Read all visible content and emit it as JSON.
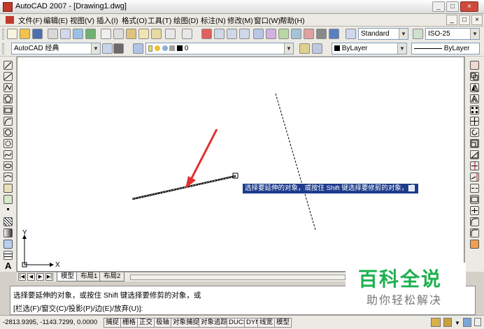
{
  "window": {
    "title": "AutoCAD 2007 - [Drawing1.dwg]",
    "controls": [
      "_",
      "□",
      "×"
    ]
  },
  "menubar": {
    "items": [
      "文件(F)",
      "编辑(E)",
      "视图(V)",
      "插入(I)",
      "格式(O)",
      "工具(T)",
      "绘图(D)",
      "标注(N)",
      "修改(M)",
      "窗口(W)",
      "帮助(H)"
    ],
    "doc_controls": [
      "_",
      "□",
      "×"
    ]
  },
  "toolbar_standard": {
    "text_style": "Standard",
    "dim_style": "ISO-25"
  },
  "toolbar_layers": {
    "workspace": "AutoCAD 经典",
    "current_layer": "0",
    "color": "ByLayer",
    "linetype": "ByLayer"
  },
  "canvas": {
    "ucs_x_label": "X",
    "ucs_y_label": "Y",
    "tooltip_text": "选择要延伸的对象，或按住 Shift 键选择要修剪的对象，或",
    "accent_arrow_color": "#e03030",
    "line_color": "#000000"
  },
  "layout_tabs": {
    "nav": [
      "|◀",
      "◀",
      "▶",
      "▶|"
    ],
    "tabs": [
      "模型",
      "布局1",
      "布局2"
    ],
    "active": "模型"
  },
  "command": {
    "line1": "选择要延伸的对象，或按住 Shift 键选择要修剪的对象，或",
    "line2": "[栏选(F)/窗交(C)/投影(P)/边(E)/放弃(U)]:"
  },
  "statusbar": {
    "coordinates": "-2813.9395, -1143.7299, 0.0000",
    "toggles": [
      "捕捉",
      "栅格",
      "正交",
      "极轴",
      "对象捕捉",
      "对象追踪",
      "DUCS",
      "DYN",
      "线宽",
      "模型"
    ]
  },
  "watermark": {
    "logo": "百科全说",
    "subtitle": "助你轻松解决"
  },
  "icons": {
    "left_toolbar": [
      "line-icon",
      "construction-line-icon",
      "polyline-icon",
      "polygon-icon",
      "rectangle-icon",
      "arc-icon",
      "circle-icon",
      "revision-cloud-icon",
      "spline-icon",
      "ellipse-icon",
      "ellipse-arc-icon",
      "insert-block-icon",
      "make-block-icon",
      "point-icon",
      "hatch-icon",
      "gradient-icon",
      "region-icon",
      "table-icon",
      "mtext-icon"
    ],
    "right_toolbar": [
      "erase-icon",
      "copy-icon",
      "mirror-icon",
      "offset-icon",
      "array-icon",
      "move-icon",
      "rotate-icon",
      "scale-icon",
      "stretch-icon",
      "trim-icon",
      "extend-icon",
      "break-at-point-icon",
      "break-icon",
      "join-icon",
      "chamfer-icon",
      "fillet-icon",
      "explode-icon"
    ]
  }
}
